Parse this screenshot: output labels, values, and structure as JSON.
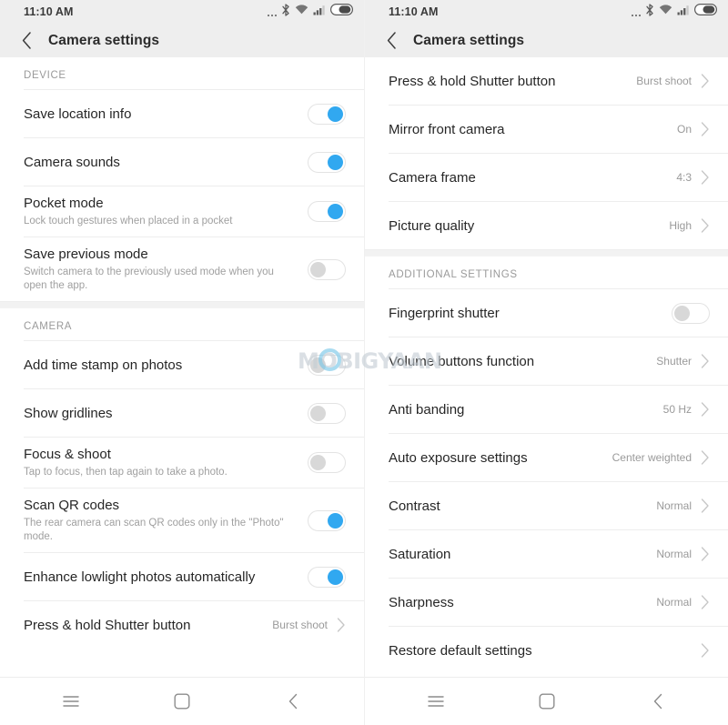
{
  "watermark": {
    "text": "MOBIGYAAN"
  },
  "navbar": {
    "menu_label": "menu-icon",
    "home_label": "home-icon",
    "back_label": "back-icon"
  },
  "left_screen": {
    "status": {
      "time": "11:10 AM",
      "icons": [
        "more-dots-icon",
        "bluetooth-icon",
        "wifi-icon",
        "signal-icon",
        "battery-icon"
      ]
    },
    "appbar": {
      "title": "Camera settings",
      "back_icon": "back-chevron-icon"
    },
    "sections": [
      {
        "header": "DEVICE",
        "rows": [
          {
            "title": "Save location info",
            "sub": "",
            "control": "toggle",
            "state": "on"
          },
          {
            "title": "Camera sounds",
            "sub": "",
            "control": "toggle",
            "state": "on"
          },
          {
            "title": "Pocket mode",
            "sub": "Lock touch gestures when placed in a pocket",
            "control": "toggle",
            "state": "on"
          },
          {
            "title": "Save previous mode",
            "sub": "Switch camera to the previously used mode when you open the app.",
            "control": "toggle",
            "state": "off"
          }
        ]
      },
      {
        "header": "CAMERA",
        "rows": [
          {
            "title": "Add time stamp on photos",
            "sub": "",
            "control": "toggle",
            "state": "off"
          },
          {
            "title": "Show gridlines",
            "sub": "",
            "control": "toggle",
            "state": "off"
          },
          {
            "title": "Focus & shoot",
            "sub": "Tap to focus, then tap again to take a photo.",
            "control": "toggle",
            "state": "off"
          },
          {
            "title": "Scan QR codes",
            "sub": "The rear camera can scan QR codes only in the \"Photo\" mode.",
            "control": "toggle",
            "state": "on"
          },
          {
            "title": "Enhance lowlight photos automatically",
            "sub": "",
            "control": "toggle",
            "state": "on"
          },
          {
            "title": "Press & hold Shutter button",
            "sub": "",
            "control": "value",
            "value": "Burst shoot"
          }
        ]
      }
    ]
  },
  "right_screen": {
    "status": {
      "time": "11:10 AM",
      "icons": [
        "more-dots-icon",
        "bluetooth-icon",
        "wifi-icon",
        "signal-icon",
        "battery-icon"
      ]
    },
    "appbar": {
      "title": "Camera settings",
      "back_icon": "back-chevron-icon"
    },
    "sections": [
      {
        "header": "",
        "rows": [
          {
            "title": "Press & hold Shutter button",
            "sub": "",
            "control": "value",
            "value": "Burst shoot"
          },
          {
            "title": "Mirror front camera",
            "sub": "",
            "control": "value",
            "value": "On"
          },
          {
            "title": "Camera frame",
            "sub": "",
            "control": "value",
            "value": "4:3"
          },
          {
            "title": "Picture quality",
            "sub": "",
            "control": "value",
            "value": "High"
          }
        ]
      },
      {
        "header": "ADDITIONAL SETTINGS",
        "rows": [
          {
            "title": "Fingerprint shutter",
            "sub": "",
            "control": "toggle",
            "state": "off"
          },
          {
            "title": "Volume buttons function",
            "sub": "",
            "control": "value",
            "value": "Shutter"
          },
          {
            "title": "Anti banding",
            "sub": "",
            "control": "value",
            "value": "50 Hz"
          },
          {
            "title": "Auto exposure settings",
            "sub": "",
            "control": "value",
            "value": "Center weighted"
          },
          {
            "title": "Contrast",
            "sub": "",
            "control": "value",
            "value": "Normal"
          },
          {
            "title": "Saturation",
            "sub": "",
            "control": "value",
            "value": "Normal"
          },
          {
            "title": "Sharpness",
            "sub": "",
            "control": "value",
            "value": "Normal"
          },
          {
            "title": "Restore default settings",
            "sub": "",
            "control": "value",
            "value": ""
          }
        ]
      }
    ]
  },
  "colors": {
    "accent": "#31a8f0",
    "appbar_bg": "#eeeeee",
    "text_primary": "#262626",
    "text_secondary": "#9a9a9a"
  }
}
